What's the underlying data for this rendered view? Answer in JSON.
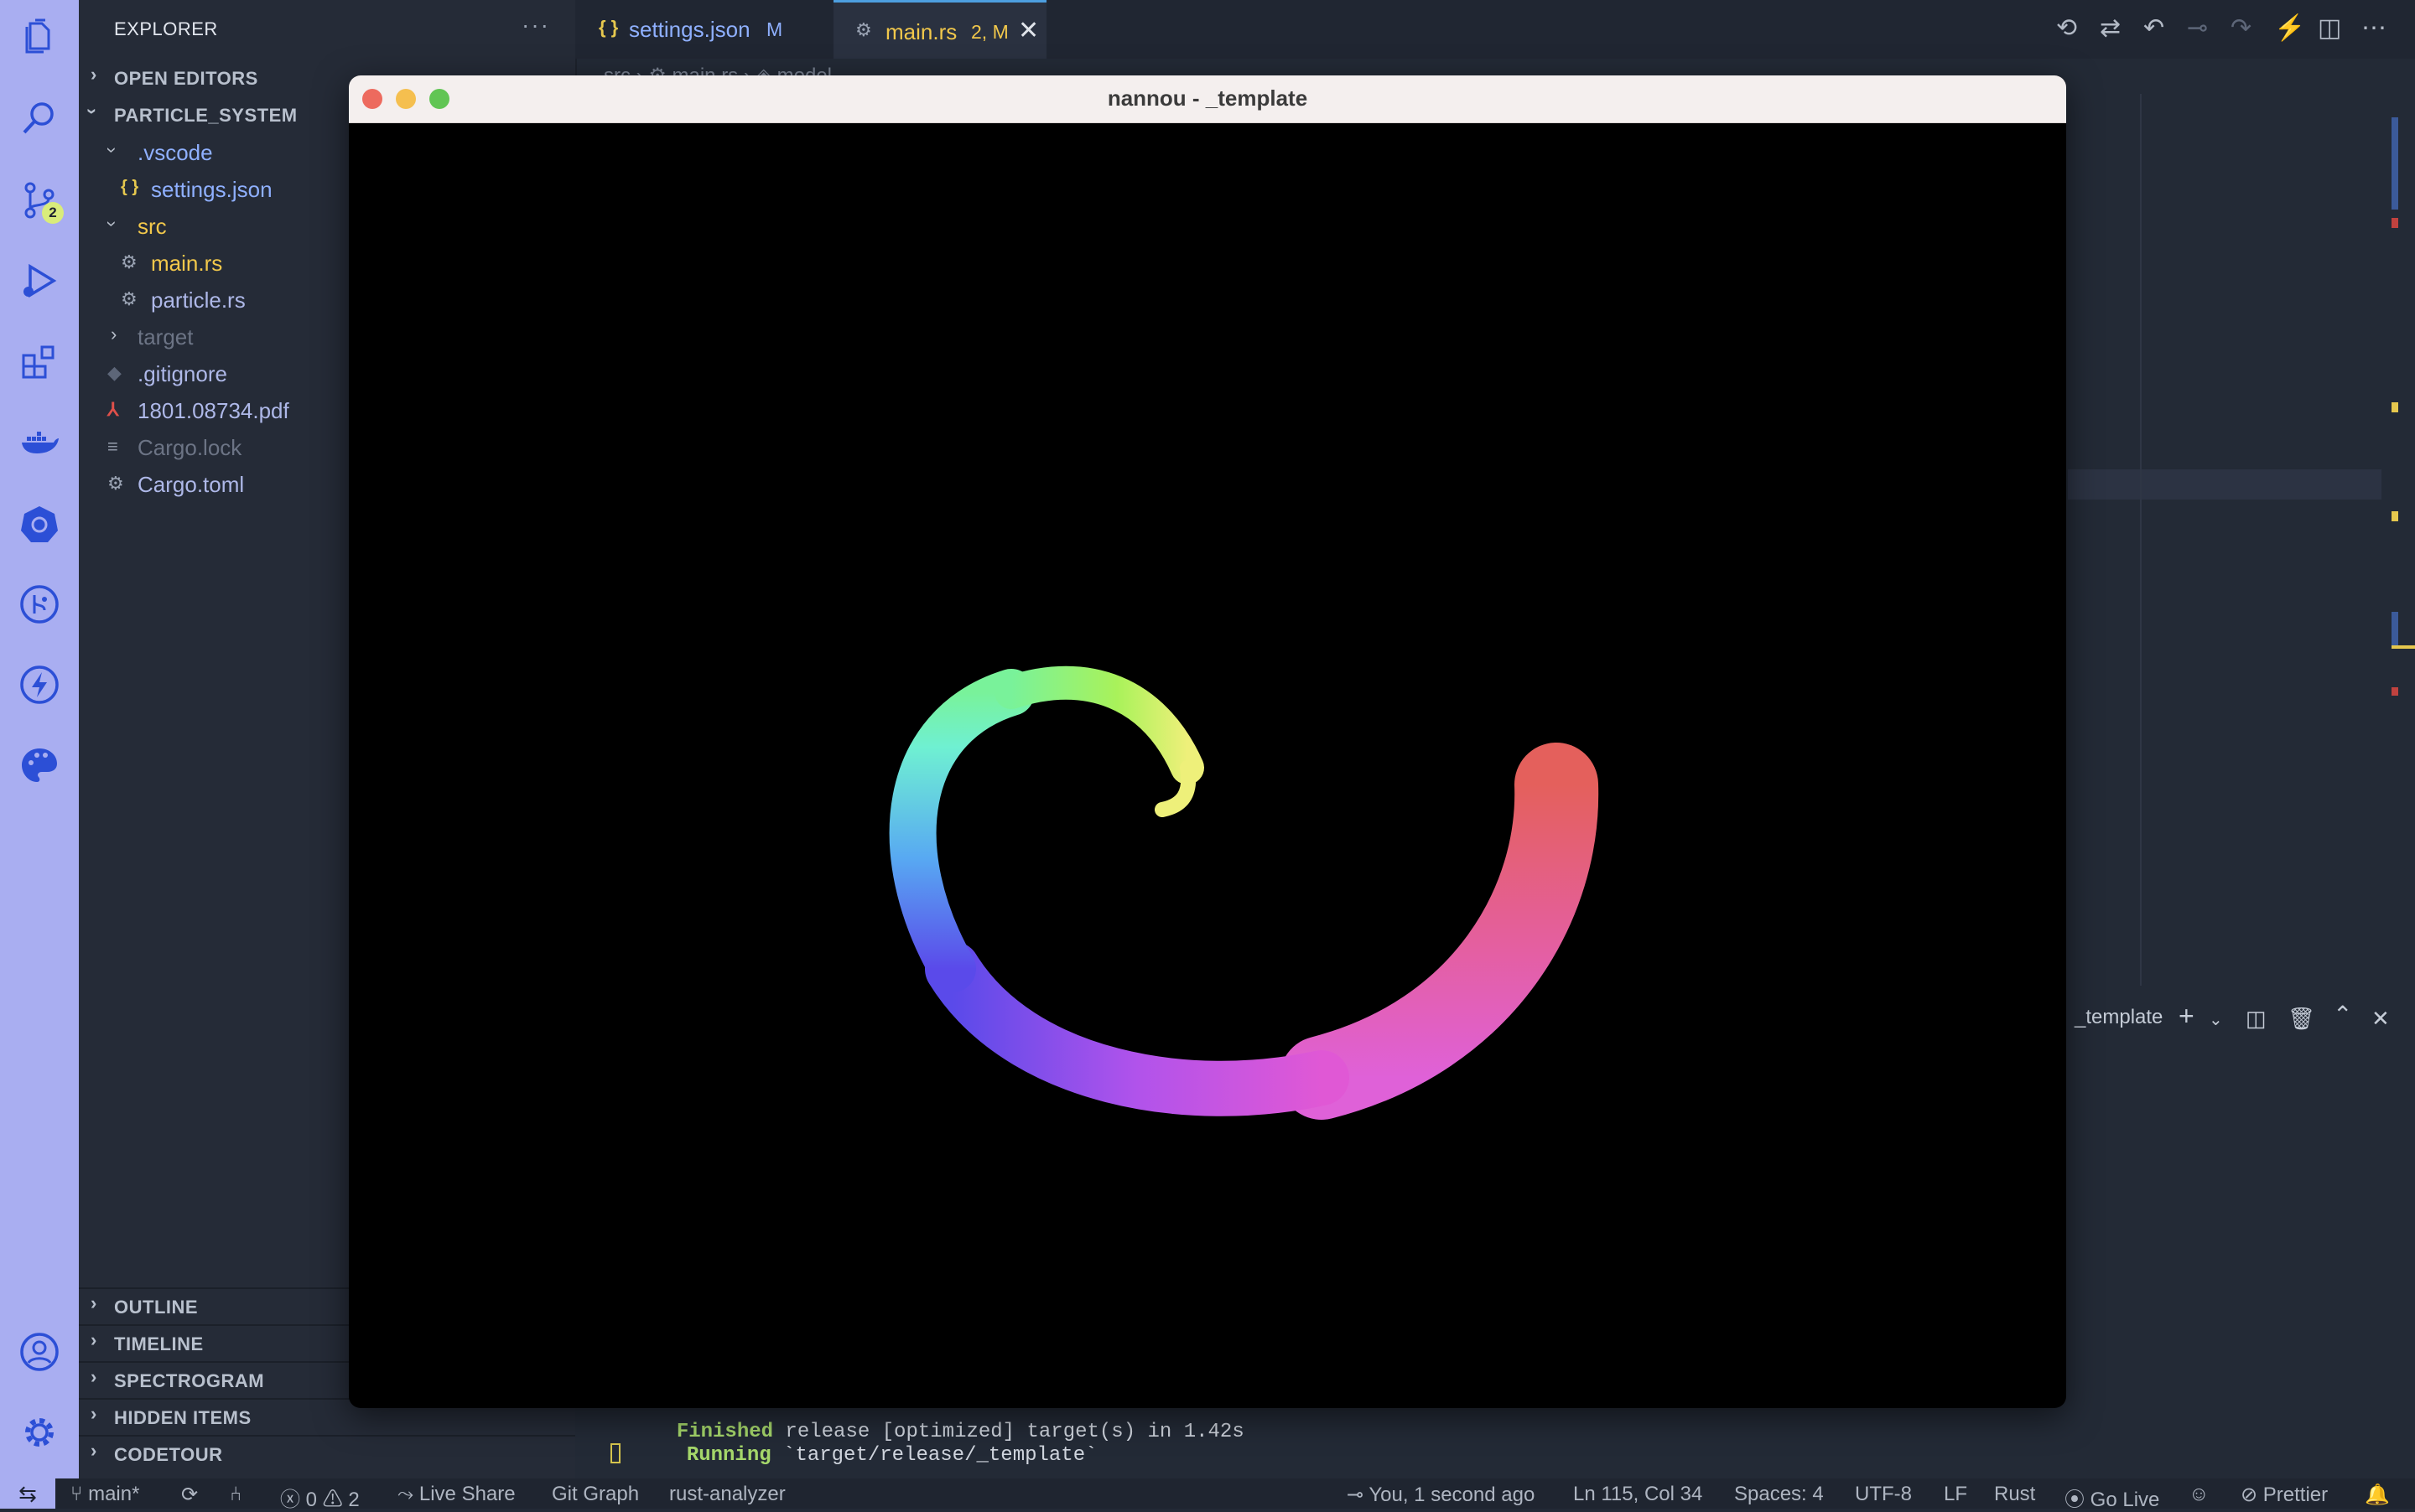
{
  "activity_bar": {
    "icons": [
      "files-icon",
      "search-icon",
      "source-control-icon",
      "run-debug-icon",
      "extensions-icon",
      "docker-icon",
      "kubernetes-icon",
      "git-graph-icon",
      "lightning-icon",
      "theme-palette-icon",
      "account-icon",
      "settings-gear-icon"
    ],
    "source_control_badge": "2"
  },
  "sidebar": {
    "title": "EXPLORER",
    "more": "···",
    "sections_top": {
      "open_editors": "OPEN EDITORS",
      "project": "PARTICLE_SYSTEM"
    },
    "tree": [
      {
        "name": ".vscode",
        "kind": "folder-open",
        "color": "#8fb0ff"
      },
      {
        "name": "settings.json",
        "kind": "json",
        "icon": "{ }",
        "color": "#8fb0ff"
      },
      {
        "name": "src",
        "kind": "folder-open",
        "color": "#f2c84b"
      },
      {
        "name": "main.rs",
        "kind": "rust",
        "icon": "⚙",
        "color": "#f2c84b"
      },
      {
        "name": "particle.rs",
        "kind": "rust",
        "icon": "⚙",
        "color": "#aeb8e8"
      },
      {
        "name": "target",
        "kind": "folder-closed",
        "color": "#6c7485"
      },
      {
        "name": ".gitignore",
        "kind": "git",
        "icon": "◆",
        "color": "#aeb8e8"
      },
      {
        "name": "1801.08734.pdf",
        "kind": "pdf",
        "icon": "⅄",
        "color": "#aeb8e8"
      },
      {
        "name": "Cargo.lock",
        "kind": "lock",
        "icon": "≡",
        "color": "#6c7485"
      },
      {
        "name": "Cargo.toml",
        "kind": "toml",
        "icon": "⚙",
        "color": "#aeb8e8"
      }
    ],
    "sections_bottom": [
      "OUTLINE",
      "TIMELINE",
      "SPECTROGRAM",
      "HIDDEN ITEMS",
      "CODETOUR"
    ]
  },
  "tabs": [
    {
      "name": "settings.json",
      "status": "M",
      "icon": "{ }"
    },
    {
      "name": "main.rs",
      "status": "2, M",
      "icon": "⚙",
      "close": "✕"
    }
  ],
  "breadcrumb": "src  ›  ⚙ main.rs  ›  ◈ model",
  "terminal": {
    "panel_title": "_template",
    "lines": [
      {
        "bold": "Finished",
        "rest": " release [optimized] target(s) in 1.42s"
      },
      {
        "bold": "Running",
        "rest": " `target/release/_template`"
      }
    ]
  },
  "nannou_window": {
    "title": "nannou - _template",
    "traffic_lights": {
      "close": "#ed6a5e",
      "minimize": "#f5bf4f",
      "maximize": "#61c554"
    }
  },
  "status_bar": {
    "branch": "main*",
    "errors": "0",
    "warnings": "2",
    "live_share": "Live Share",
    "git_graph": "Git Graph",
    "rust_analyzer": "rust-analyzer",
    "blame": "You, 1 second ago",
    "cursor": "Ln 115, Col 34",
    "spaces": "Spaces: 4",
    "encoding": "UTF-8",
    "eol": "LF",
    "language": "Rust",
    "go_live": "Go Live",
    "prettier": "Prettier"
  }
}
